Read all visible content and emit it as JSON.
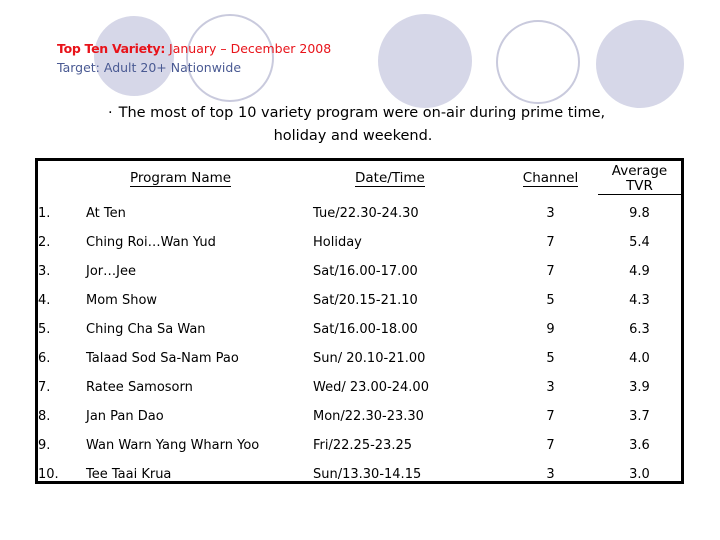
{
  "slide": {
    "heading": {
      "label": "Top Ten Variety:",
      "period": "January – December 2008",
      "target": "Target: Adult 20+ Nationwide",
      "label_color": "#e8131a",
      "period_color": "#e8131a",
      "target_color": "#4a5a93"
    },
    "bullet": {
      "marker": "·",
      "line1": "The most of top 10 variety program were on-air during prime time,",
      "line2": "holiday and weekend."
    },
    "decor": {
      "circle_fill_color": "#d6d7e8",
      "circle_outline_color": "#c9cadd"
    }
  },
  "table": {
    "headers": {
      "rank": "",
      "program_name": "Program Name",
      "date_time": "Date/Time",
      "channel": "Channel",
      "average_tvr": "Average TVR"
    },
    "rows": [
      {
        "rank": "1.",
        "program_name": "At Ten",
        "date_time": "Tue/22.30-24.30",
        "channel": "3",
        "average_tvr": "9.8"
      },
      {
        "rank": "2.",
        "program_name": "Ching Roi…Wan Yud",
        "date_time": "Holiday",
        "channel": "7",
        "average_tvr": "5.4"
      },
      {
        "rank": "3.",
        "program_name": "Jor…Jee",
        "date_time": "Sat/16.00-17.00",
        "channel": "7",
        "average_tvr": "4.9"
      },
      {
        "rank": "4.",
        "program_name": "Mom Show",
        "date_time": "Sat/20.15-21.10",
        "channel": "5",
        "average_tvr": "4.3"
      },
      {
        "rank": "5.",
        "program_name": "Ching Cha Sa Wan",
        "date_time": "Sat/16.00-18.00",
        "channel": "9",
        "average_tvr": "6.3"
      },
      {
        "rank": "6.",
        "program_name": "Talaad Sod Sa-Nam Pao",
        "date_time": "Sun/ 20.10-21.00",
        "channel": "5",
        "average_tvr": "4.0"
      },
      {
        "rank": "7.",
        "program_name": "Ratee Samosorn",
        "date_time": "Wed/ 23.00-24.00",
        "channel": "3",
        "average_tvr": "3.9"
      },
      {
        "rank": "8.",
        "program_name": "Jan Pan Dao",
        "date_time": "Mon/22.30-23.30",
        "channel": "7",
        "average_tvr": "3.7"
      },
      {
        "rank": "9.",
        "program_name": "Wan Warn Yang Wharn Yoo",
        "date_time": "Fri/22.25-23.25",
        "channel": "7",
        "average_tvr": "3.6"
      },
      {
        "rank": "10.",
        "program_name": "Tee Taai Krua",
        "date_time": "Sun/13.30-14.15",
        "channel": "3",
        "average_tvr": "3.0"
      }
    ]
  }
}
